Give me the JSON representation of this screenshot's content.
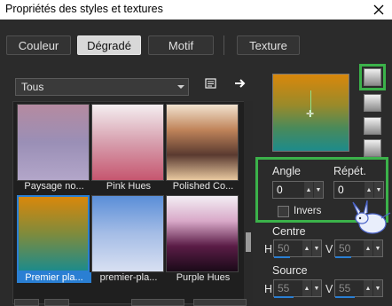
{
  "window": {
    "title": "Propriétés des styles et textures"
  },
  "tabs": [
    {
      "label": "Couleur"
    },
    {
      "label": "Dégradé"
    },
    {
      "label": "Motif"
    },
    {
      "label": "Texture"
    }
  ],
  "category": {
    "selected": "Tous"
  },
  "gallery": {
    "items": [
      {
        "label": "Paysage no...",
        "colors": [
          "#b58aa0",
          "#9a8fb6",
          "#b3a6c9"
        ]
      },
      {
        "label": "Pink Hues",
        "colors": [
          "#f4eef0",
          "#d79fae",
          "#c6566f"
        ]
      },
      {
        "label": "Polished Co...",
        "colors": [
          "#f1e2cf",
          "#c0845a",
          "#5a3a30",
          "#e8c8a0"
        ]
      },
      {
        "label": "Premier pla...",
        "colors": [
          "#d9870b",
          "#7f8b3c",
          "#1d8b8b"
        ]
      },
      {
        "label": "premier-pla...",
        "colors": [
          "#5a8ed8",
          "#a5bde6",
          "#d8e0f2"
        ]
      },
      {
        "label": "Purple Hues",
        "colors": [
          "#f3eef4",
          "#d8a8c8",
          "#5a1c46",
          "#1a0a18"
        ]
      }
    ],
    "selected_index": 3
  },
  "angle": {
    "label": "Angle",
    "value": "0"
  },
  "repeat": {
    "label": "Répét.",
    "value": "0"
  },
  "invert": {
    "label": "Invers",
    "checked": false
  },
  "center": {
    "label": "Centre",
    "h_label": "H",
    "h_value": "50",
    "v_label": "V",
    "v_value": "50"
  },
  "source": {
    "label": "Source",
    "h_label": "H",
    "h_value": "55",
    "v_label": "V",
    "v_value": "55"
  },
  "accent": "#3bb24a",
  "selection": "#2a7fd3",
  "icons": [
    "close-icon",
    "edit-icon",
    "arrow-right-icon",
    "spin-up-icon",
    "spin-down-icon"
  ]
}
